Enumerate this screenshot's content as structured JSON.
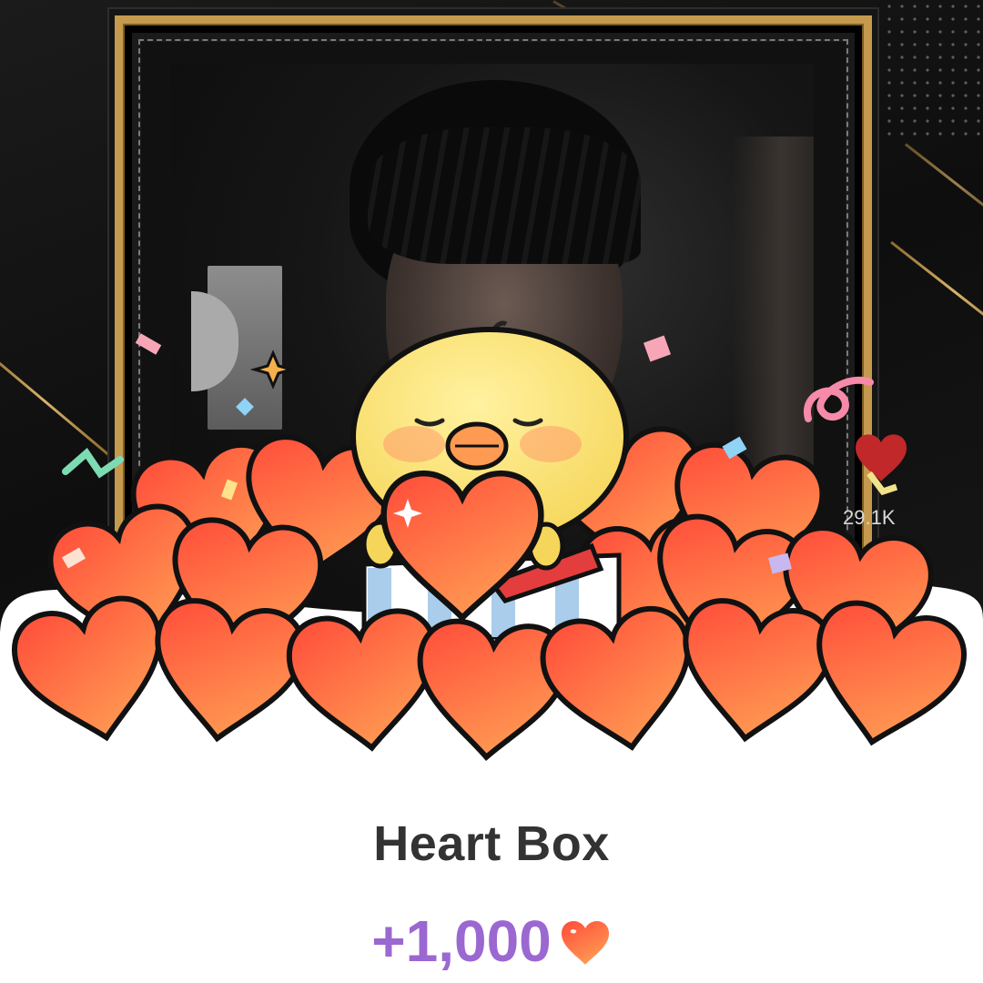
{
  "stream": {
    "like_count": "29.1K"
  },
  "gift": {
    "name": "Heart Box",
    "value": "+1,000",
    "currency_icon": "heart-icon"
  },
  "colors": {
    "value_purple": "#9b68d1",
    "heart_red": "#ff5a3c",
    "gold": "#c59a4f"
  }
}
